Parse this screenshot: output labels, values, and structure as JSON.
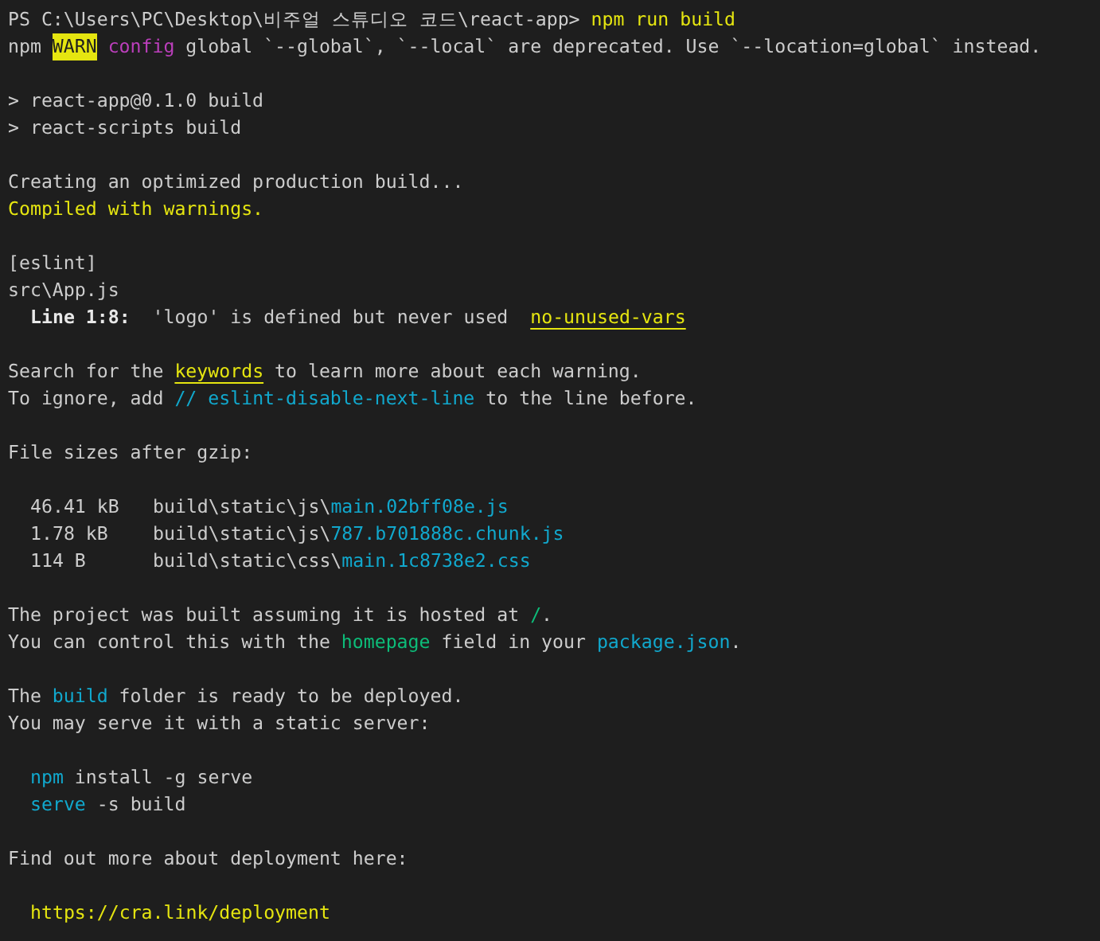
{
  "terminal": {
    "lines": [
      {
        "kind": "text",
        "indented": false,
        "segments": [
          {
            "text": "PS C:\\Users\\PC\\Desktop\\비주얼 스튜디오 코드\\react-app> ",
            "kind": "plain"
          },
          {
            "text": "npm run build",
            "kind": "command"
          }
        ]
      },
      {
        "kind": "text",
        "indented": false,
        "segments": [
          {
            "text": "npm ",
            "kind": "plain"
          },
          {
            "text": "WARN",
            "kind": "warn"
          },
          {
            "text": "config",
            "kind": "keyword"
          },
          {
            "text": " global `--global`, `--local` are deprecated. Use `--location=global` instead.",
            "kind": "plain"
          }
        ]
      },
      {
        "kind": "blank"
      },
      {
        "kind": "text",
        "indented": false,
        "segments": [
          {
            "text": "> react-app@0.1.0 build",
            "kind": "plain"
          }
        ]
      },
      {
        "kind": "text",
        "indented": false,
        "segments": [
          {
            "text": "> react-scripts build",
            "kind": "plain"
          }
        ]
      },
      {
        "kind": "blank"
      },
      {
        "kind": "text",
        "indented": false,
        "segments": [
          {
            "text": "Creating an optimized production build...",
            "kind": "plain"
          }
        ]
      },
      {
        "kind": "text",
        "indented": false,
        "segments": [
          {
            "text": "Compiled with warnings.",
            "kind": "command"
          }
        ]
      },
      {
        "kind": "blank"
      },
      {
        "kind": "text",
        "indented": false,
        "segments": [
          {
            "text": "[eslint]",
            "kind": "plain"
          }
        ]
      },
      {
        "kind": "text",
        "indented": false,
        "segments": [
          {
            "text": "src\\App.js",
            "kind": "plain"
          }
        ]
      },
      {
        "kind": "text",
        "indented": true,
        "segments": [
          {
            "text": "Line 1:8:",
            "kind": "label"
          },
          {
            "text": "  'logo' is defined but never used  ",
            "kind": "plain"
          },
          {
            "text": "no-unused-vars",
            "kind": "rule"
          }
        ]
      },
      {
        "kind": "blank"
      },
      {
        "kind": "text",
        "indented": false,
        "segments": [
          {
            "text": "Search for the ",
            "kind": "plain"
          },
          {
            "text": "keywords",
            "kind": "rule"
          },
          {
            "text": " to learn more about each warning.",
            "kind": "plain"
          }
        ]
      },
      {
        "kind": "text",
        "indented": false,
        "segments": [
          {
            "text": "To ignore, add ",
            "kind": "plain"
          },
          {
            "text": "// eslint-disable-next-line",
            "kind": "path"
          },
          {
            "text": " to the line before.",
            "kind": "plain"
          }
        ]
      },
      {
        "kind": "blank"
      },
      {
        "kind": "text",
        "indented": false,
        "segments": [
          {
            "text": "File sizes after gzip:",
            "kind": "plain"
          }
        ]
      },
      {
        "kind": "blank"
      },
      {
        "kind": "file",
        "size": "46.41 kB",
        "folder": "build\\static\\js\\",
        "file": "main.02bff08e.js"
      },
      {
        "kind": "file",
        "size": "1.78 kB",
        "folder": "build\\static\\js\\",
        "file": "787.b701888c.chunk.js"
      },
      {
        "kind": "file",
        "size": "114 B",
        "folder": "build\\static\\css\\",
        "file": "main.1c8738e2.css"
      },
      {
        "kind": "blank"
      },
      {
        "kind": "text",
        "indented": false,
        "segments": [
          {
            "text": "The project was built assuming it is hosted at ",
            "kind": "plain"
          },
          {
            "text": "/",
            "kind": "value"
          },
          {
            "text": ".",
            "kind": "plain"
          }
        ]
      },
      {
        "kind": "text",
        "indented": false,
        "segments": [
          {
            "text": "You can control this with the ",
            "kind": "plain"
          },
          {
            "text": "homepage",
            "kind": "value"
          },
          {
            "text": " field in your ",
            "kind": "plain"
          },
          {
            "text": "package.json",
            "kind": "path"
          },
          {
            "text": ".",
            "kind": "plain"
          }
        ]
      },
      {
        "kind": "blank"
      },
      {
        "kind": "text",
        "indented": false,
        "segments": [
          {
            "text": "The ",
            "kind": "plain"
          },
          {
            "text": "build",
            "kind": "path"
          },
          {
            "text": " folder is ready to be deployed.",
            "kind": "plain"
          }
        ]
      },
      {
        "kind": "text",
        "indented": false,
        "segments": [
          {
            "text": "You may serve it with a static server:",
            "kind": "plain"
          }
        ]
      },
      {
        "kind": "blank"
      },
      {
        "kind": "text",
        "indented": true,
        "segments": [
          {
            "text": "npm",
            "kind": "path"
          },
          {
            "text": " install -g serve",
            "kind": "plain"
          }
        ]
      },
      {
        "kind": "text",
        "indented": true,
        "segments": [
          {
            "text": "serve",
            "kind": "path"
          },
          {
            "text": " -s build",
            "kind": "plain"
          }
        ]
      },
      {
        "kind": "blank"
      },
      {
        "kind": "text",
        "indented": false,
        "segments": [
          {
            "text": "Find out more about deployment here:",
            "kind": "plain"
          }
        ]
      },
      {
        "kind": "blank"
      },
      {
        "kind": "text",
        "indented": true,
        "segments": [
          {
            "text": "https://cra.link/deployment",
            "kind": "command"
          }
        ]
      }
    ]
  }
}
